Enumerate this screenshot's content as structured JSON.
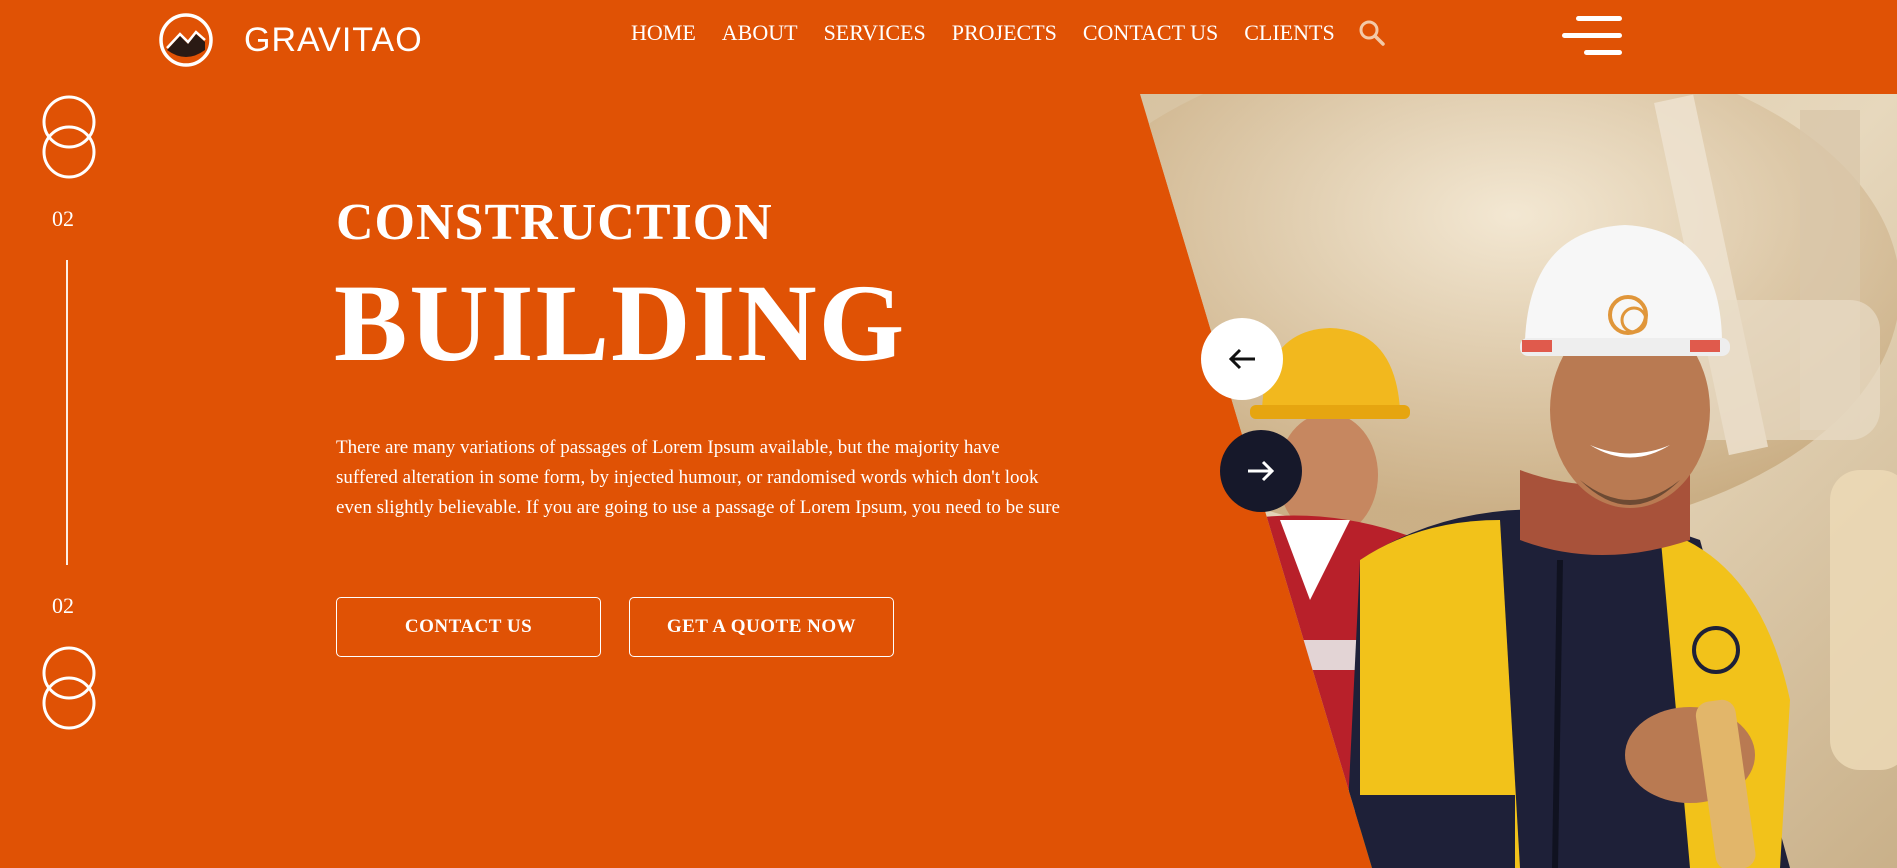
{
  "brand": {
    "name": "GRAVITAO",
    "logo_icon": "mountain-circle-logo"
  },
  "nav": {
    "items": [
      {
        "label": "HOME"
      },
      {
        "label": "ABOUT"
      },
      {
        "label": "SERVICES"
      },
      {
        "label": "PROJECTS"
      },
      {
        "label": "CONTACT US"
      },
      {
        "label": "CLIENTS"
      }
    ],
    "search_icon": "search-icon",
    "menu_icon": "hamburger-menu-icon"
  },
  "slider": {
    "current": "02",
    "total": "02",
    "prev_icon": "arrow-left-icon",
    "next_icon": "arrow-right-icon"
  },
  "hero": {
    "subtitle": "CONSTRUCTION",
    "title": "BUILDING",
    "description_lines": [
      "There are many variations of passages of Lorem Ipsum available, but the majority have",
      "suffered alteration in some form, by injected humour, or randomised words which don't look",
      "even slightly believable. If you are going to use a passage of Lorem Ipsum, you need to be sure"
    ],
    "buttons": {
      "contact": "CONTACT US",
      "quote": "GET A QUOTE NOW"
    }
  },
  "colors": {
    "background": "#e05205",
    "text": "#ffffff",
    "next_button": "#16182a",
    "prev_button": "#ffffff"
  }
}
